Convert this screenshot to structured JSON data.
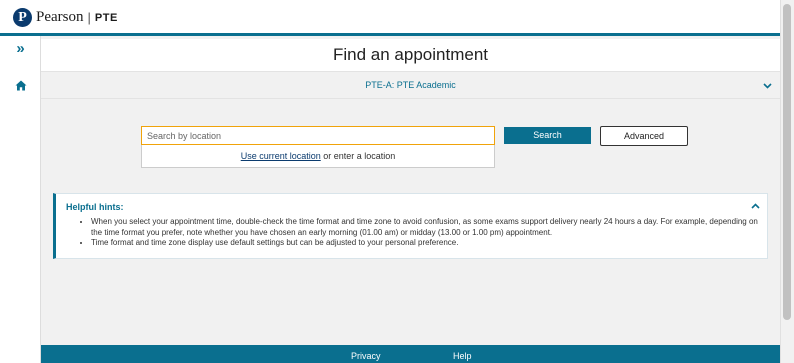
{
  "header": {
    "logo_mark": "P",
    "brand": "Pearson",
    "separator": "|",
    "product": "PTE"
  },
  "sidebar": {
    "expand_icon": "double-chevron-right-icon",
    "expand_glyph": "»",
    "home_icon": "home-icon"
  },
  "page": {
    "title": "Find an appointment",
    "exam": "PTE-A: PTE Academic",
    "exam_toggle_icon": "chevron-down-icon"
  },
  "search": {
    "placeholder": "Search by location",
    "value": "",
    "button_label": "Search",
    "advanced_label": "Advanced",
    "use_location_link": "Use current location",
    "or_text": " or enter a location"
  },
  "hints": {
    "title": "Helpful hints:",
    "toggle_icon": "chevron-up-icon",
    "items": [
      "When you select your appointment time, double-check the time format and time zone to avoid confusion, as some exams support delivery nearly 24 hours a day. For example, depending on the time format you prefer, note whether you have chosen an early morning (01.00 am) or midday (13.00 or 1.00 pm) appointment.",
      "Time format and time zone display use default settings but can be adjusted to your personal preference."
    ]
  },
  "footer": {
    "privacy": "Privacy",
    "help": "Help"
  },
  "colors": {
    "accent": "#0a6f8f",
    "brand_navy": "#0b3b6e",
    "focus": "#f0a30a"
  }
}
